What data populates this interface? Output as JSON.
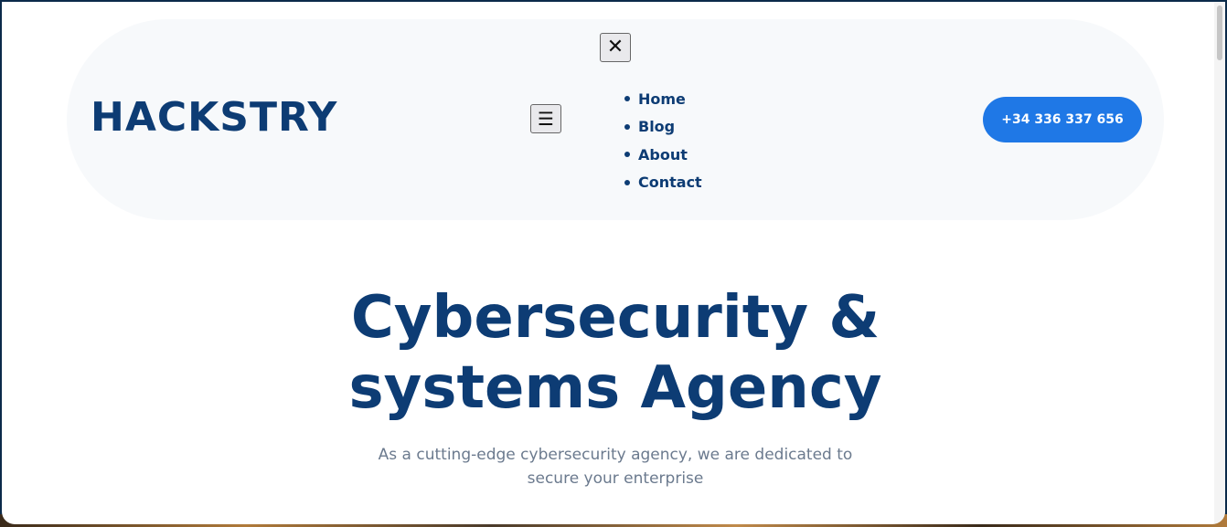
{
  "header": {
    "logo": "HACKSTRY",
    "close_icon": "✕",
    "menu_icon": "☰",
    "nav_items": [
      {
        "label": "Home"
      },
      {
        "label": "Blog"
      },
      {
        "label": "About"
      },
      {
        "label": "Contact"
      }
    ],
    "phone": "+34 336 337 656"
  },
  "hero": {
    "title_line1": "Cybersecurity &",
    "title_line2": "systems Agency",
    "subtitle_line1": "As a cutting-edge cybersecurity agency, we are dedicated to",
    "subtitle_line2": "secure your enterprise"
  },
  "colors": {
    "brand_navy": "#0d3c74",
    "accent_blue": "#1f78e6",
    "header_bg": "#f7f9fb",
    "subtitle_gray": "#6b7a8e"
  }
}
